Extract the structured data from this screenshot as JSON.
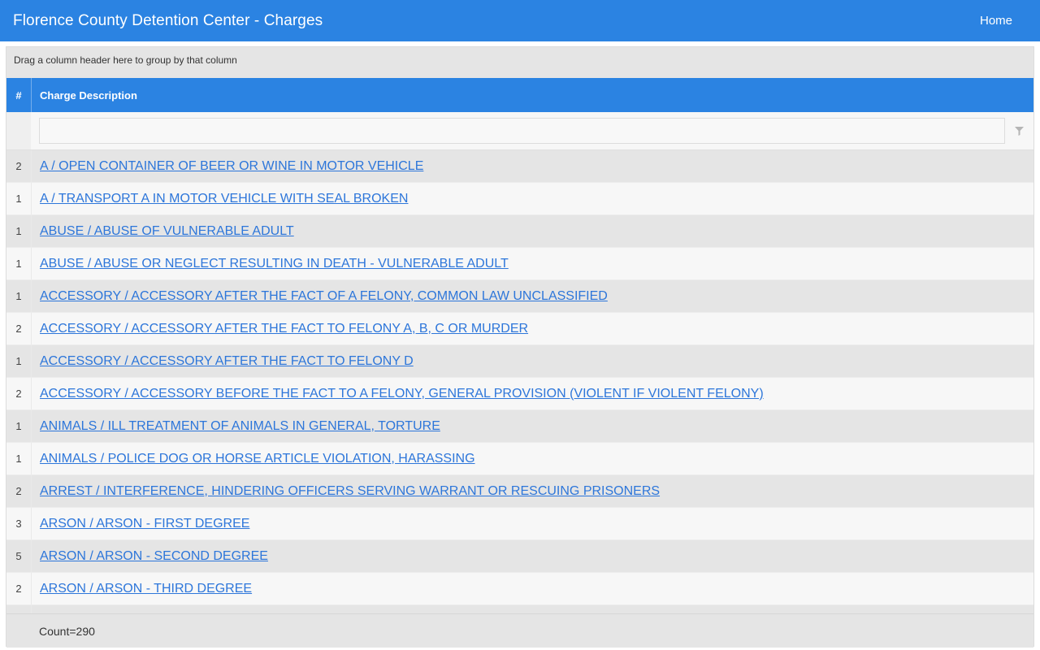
{
  "header": {
    "title": "Florence County Detention Center - Charges",
    "home_label": "Home"
  },
  "grid": {
    "group_panel_text": "Drag a column header here to group by that column",
    "columns": {
      "count": "#",
      "description": "Charge Description"
    },
    "filter_value": "",
    "footer": "Count=290",
    "rows": [
      {
        "count": "2",
        "description": "A / OPEN CONTAINER OF BEER OR WINE IN MOTOR VEHICLE"
      },
      {
        "count": "1",
        "description": "A / TRANSPORT A IN MOTOR VEHICLE WITH SEAL BROKEN"
      },
      {
        "count": "1",
        "description": "ABUSE / ABUSE OF VULNERABLE ADULT"
      },
      {
        "count": "1",
        "description": "ABUSE / ABUSE OR NEGLECT RESULTING IN DEATH - VULNERABLE ADULT"
      },
      {
        "count": "1",
        "description": "ACCESSORY / ACCESSORY AFTER THE FACT OF A FELONY, COMMON LAW UNCLASSIFIED"
      },
      {
        "count": "2",
        "description": "ACCESSORY / ACCESSORY AFTER THE FACT TO FELONY A, B, C OR MURDER"
      },
      {
        "count": "1",
        "description": "ACCESSORY / ACCESSORY AFTER THE FACT TO FELONY D"
      },
      {
        "count": "2",
        "description": "ACCESSORY / ACCESSORY BEFORE THE FACT TO A FELONY, GENERAL PROVISION (VIOLENT IF VIOLENT FELONY)"
      },
      {
        "count": "1",
        "description": "ANIMALS / ILL TREATMENT OF ANIMALS IN GENERAL, TORTURE"
      },
      {
        "count": "1",
        "description": "ANIMALS / POLICE DOG OR HORSE ARTICLE VIOLATION, HARASSING"
      },
      {
        "count": "2",
        "description": "ARREST / INTERFERENCE, HINDERING OFFICERS SERVING WARRANT OR RESCUING PRISONERS"
      },
      {
        "count": "3",
        "description": "ARSON / ARSON - FIRST DEGREE"
      },
      {
        "count": "5",
        "description": "ARSON / ARSON - SECOND DEGREE"
      },
      {
        "count": "2",
        "description": "ARSON / ARSON - THIRD DEGREE"
      },
      {
        "count": "",
        "description": ""
      }
    ]
  }
}
